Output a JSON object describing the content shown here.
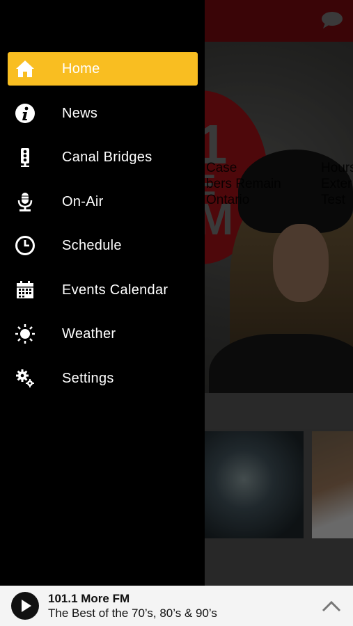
{
  "colors": {
    "accent": "#f9be21",
    "topbar": "#6b0a0d",
    "drawer_bg": "#000000",
    "logo_red": "#8e1014"
  },
  "topbar": {
    "chat_icon": "chat-bubble-icon"
  },
  "hero": {
    "logo_glyphs": [
      "1",
      "E",
      "M"
    ]
  },
  "news": {
    "cards": [
      {
        "text": "Case\nbers Remain\n Ontario"
      },
      {
        "text": "Hours\nExter\nTest"
      }
    ]
  },
  "menu": {
    "items": [
      {
        "label": "Home",
        "icon": "home-icon",
        "active": true
      },
      {
        "label": "News",
        "icon": "info-icon",
        "active": false
      },
      {
        "label": "Canal Bridges",
        "icon": "traffic-light-icon",
        "active": false
      },
      {
        "label": "On-Air",
        "icon": "microphone-icon",
        "active": false
      },
      {
        "label": "Schedule",
        "icon": "clock-icon",
        "active": false
      },
      {
        "label": "Events Calendar",
        "icon": "calendar-icon",
        "active": false
      },
      {
        "label": "Weather",
        "icon": "sun-icon",
        "active": false
      },
      {
        "label": "Settings",
        "icon": "gears-icon",
        "active": false
      }
    ]
  },
  "player": {
    "station": "101.1 More FM",
    "tagline": "The Best of the 70’s, 80’s & 90’s",
    "play_icon": "play-icon",
    "expand_icon": "chevron-up-icon"
  }
}
